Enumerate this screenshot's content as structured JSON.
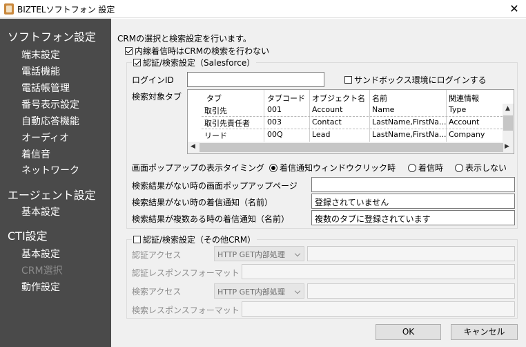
{
  "window": {
    "title": "BIZTELソフトフォン 設定",
    "close_glyph": "✕"
  },
  "sidebar": {
    "sections": [
      {
        "heading": "ソフトフォン設定",
        "items": [
          "端末設定",
          "電話機能",
          "電話帳管理",
          "番号表示設定",
          "自動応答機能",
          "オーディオ",
          "着信音",
          "ネットワーク"
        ]
      },
      {
        "heading": "エージェント設定",
        "items": [
          "基本設定"
        ]
      },
      {
        "heading": "CTI設定",
        "items": [
          "基本設定",
          "CRM選択",
          "動作設定"
        ]
      }
    ]
  },
  "main": {
    "description": "CRMの選択と検索設定を行います。",
    "internal_checkbox_label": "内線着信時はCRMの検索を行わない",
    "sf_group": {
      "legend": "認証/検索設定（Salesforce）",
      "login_label": "ログインID",
      "login_value": "",
      "sandbox_label": "サンドボックス環境にログインする",
      "tabs_label": "検索対象タブ",
      "columns": [
        "タブ",
        "タブコード",
        "オブジェクト名",
        "名前",
        "関連情報"
      ],
      "rows": [
        [
          "取引先",
          "001",
          "Account",
          "Name",
          "Type"
        ],
        [
          "取引先責任者",
          "003",
          "Contact",
          "LastName,FirstNa...",
          "Account"
        ],
        [
          "リード",
          "00Q",
          "Lead",
          "LastName,FirstNa...",
          "Company"
        ]
      ],
      "popup_timing_label": "画面ポップアップの表示タイミング",
      "popup_options": [
        "着信通知ウィンドウクリック時",
        "着信時",
        "表示しない"
      ],
      "popup_selected": "着信通知ウィンドウクリック時",
      "no_result_page_label": "検索結果がない時の画面ポップアップページ",
      "no_result_page_value": "",
      "no_result_notify_label": "検索結果がない時の着信通知（名前）",
      "no_result_notify_value": "登録されていません",
      "multi_result_notify_label": "検索結果が複数ある時の着信通知（名前）",
      "multi_result_notify_value": "複数のタブに登録されています"
    },
    "other_group": {
      "legend": "認証/検索設定（その他CRM）",
      "auth_access_label": "認証アクセス",
      "auth_access_select": "HTTP GET内部処理",
      "auth_response_label": "認証レスポンスフォーマット",
      "search_access_label": "検索アクセス",
      "search_access_select": "HTTP GET内部処理",
      "search_response_label": "検索レスポンスフォーマット"
    },
    "ok_label": "OK",
    "cancel_label": "キャンセル"
  }
}
